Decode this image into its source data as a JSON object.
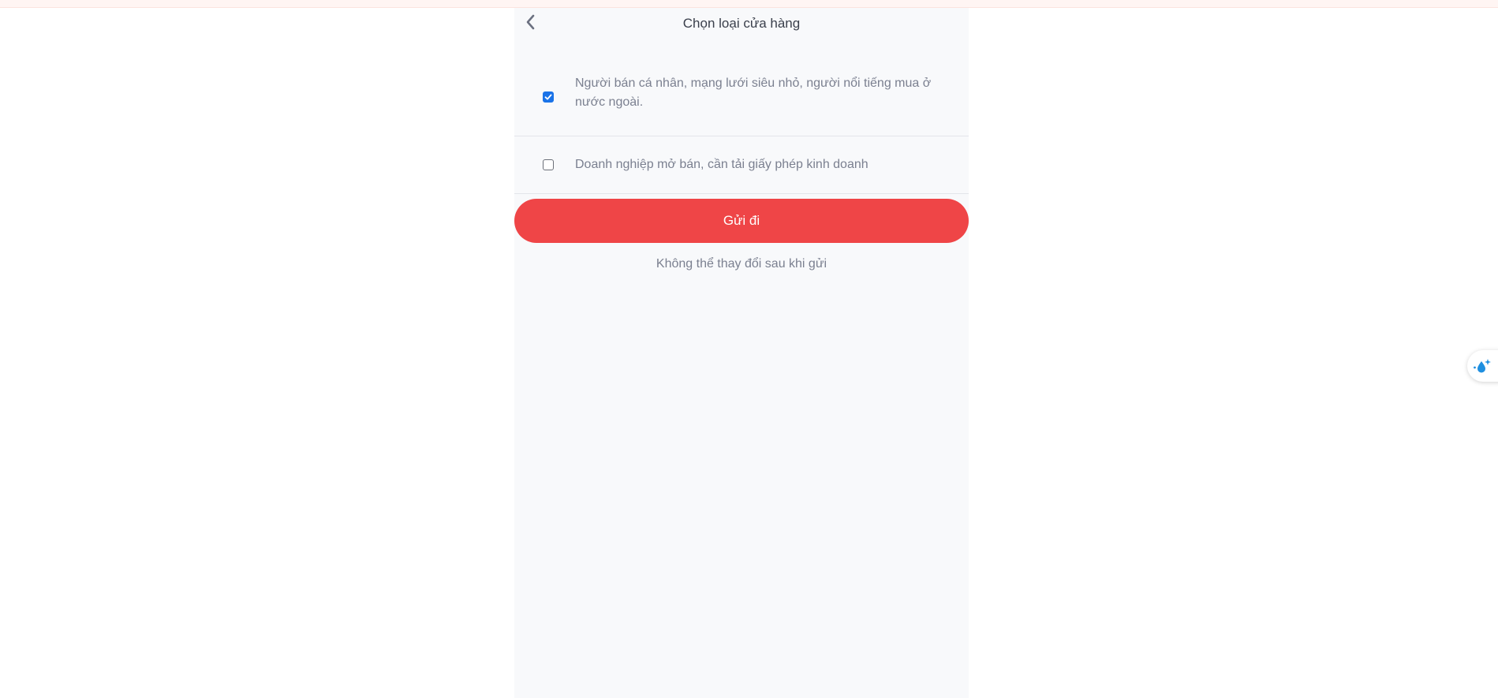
{
  "header": {
    "title": "Chọn loại cửa hàng",
    "back_icon": "chevron-left-icon"
  },
  "options": [
    {
      "label": "Người bán cá nhân, mạng lưới siêu nhỏ, người nổi tiếng mua ở nước ngoài.",
      "checked": true
    },
    {
      "label": "Doanh nghiệp mở bán, cần tải giấy phép kinh doanh",
      "checked": false
    }
  ],
  "actions": {
    "submit_label": "Gửi đi",
    "note": "Không thể thay đổi sau khi gửi"
  },
  "colors": {
    "accent": "#ef4547",
    "checkbox_checked": "#1a73e8",
    "text_muted": "#7b8090",
    "panel_bg": "#f8f9fb"
  },
  "floating_widget": {
    "icon": "sparkle-drop-icon"
  }
}
